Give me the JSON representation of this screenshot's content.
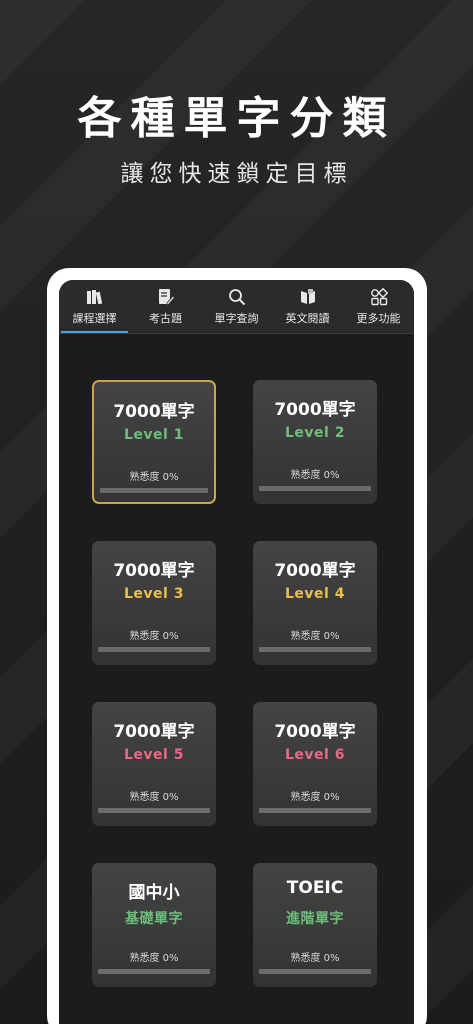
{
  "promo": {
    "title": "各種單字分類",
    "subtitle": "讓您快速鎖定目標"
  },
  "tabs": [
    {
      "label": "課程選擇",
      "icon": "books-icon",
      "active": true
    },
    {
      "label": "考古題",
      "icon": "edit-document-icon",
      "active": false
    },
    {
      "label": "單字查詢",
      "icon": "search-icon",
      "active": false
    },
    {
      "label": "英文閱讀",
      "icon": "open-book-icon",
      "active": false
    },
    {
      "label": "更多功能",
      "icon": "grid-shapes-icon",
      "active": false
    }
  ],
  "cards": [
    {
      "title": "7000單字",
      "subtitle": "Level  1",
      "sub_color": "#6dbd7c",
      "progress_label": "熟悉度 0%",
      "progress": 0,
      "selected": true
    },
    {
      "title": "7000單字",
      "subtitle": "Level  2",
      "sub_color": "#6dbd7c",
      "progress_label": "熟悉度 0%",
      "progress": 0,
      "selected": false
    },
    {
      "title": "7000單字",
      "subtitle": "Level  3",
      "sub_color": "#e8c04d",
      "progress_label": "熟悉度 0%",
      "progress": 0,
      "selected": false
    },
    {
      "title": "7000單字",
      "subtitle": "Level  4",
      "sub_color": "#e8c04d",
      "progress_label": "熟悉度 0%",
      "progress": 0,
      "selected": false
    },
    {
      "title": "7000單字",
      "subtitle": "Level  5",
      "sub_color": "#ea6a86",
      "progress_label": "熟悉度 0%",
      "progress": 0,
      "selected": false
    },
    {
      "title": "7000單字",
      "subtitle": "Level  6",
      "sub_color": "#ea6a86",
      "progress_label": "熟悉度 0%",
      "progress": 0,
      "selected": false
    },
    {
      "title": "國中小",
      "subtitle": "基礎單字",
      "sub_color": "#6dbd7c",
      "progress_label": "熟悉度 0%",
      "progress": 0,
      "selected": false
    },
    {
      "title": "TOEIC",
      "subtitle": "進階單字",
      "sub_color": "#6dbd7c",
      "progress_label": "熟悉度 0%",
      "progress": 0,
      "selected": false
    }
  ],
  "colors": {
    "active_tab_underline": "#4aa3e0",
    "selected_border": "#c9a64a"
  }
}
